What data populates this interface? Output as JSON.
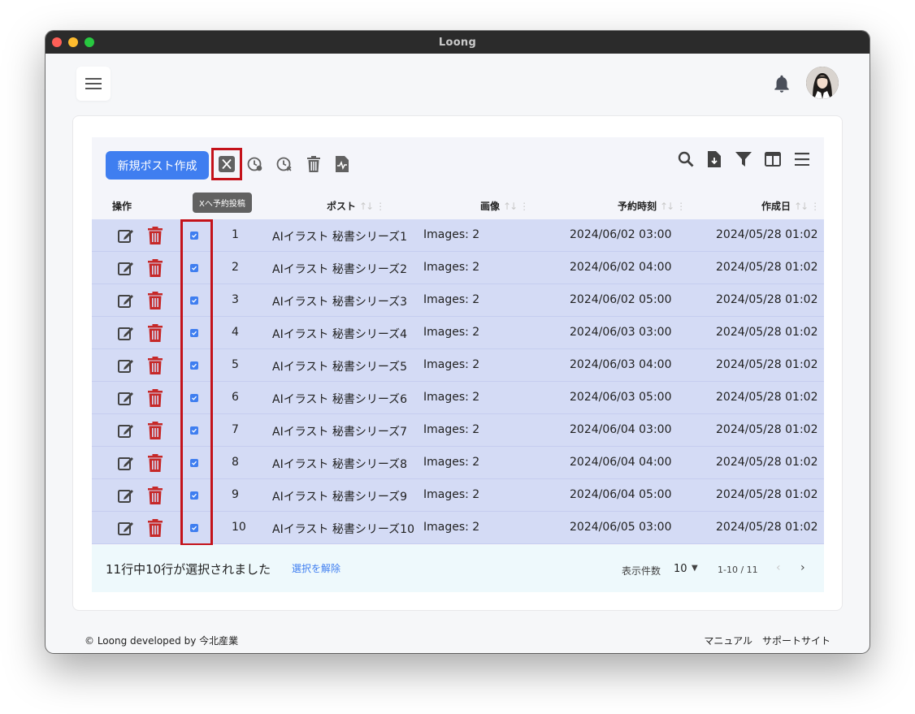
{
  "window": {
    "title": "Loong"
  },
  "toolbar": {
    "new_post_label": "新規ポスト作成",
    "tooltip": "Xへ予約投稿"
  },
  "columns": {
    "actions": "操作",
    "post": "ポスト",
    "image": "画像",
    "scheduled": "予約時刻",
    "created": "作成日"
  },
  "rows": [
    {
      "id": "1",
      "post": "AIイラスト 秘書シリーズ1",
      "image": "Images: 2",
      "scheduled": "2024/06/02 03:00",
      "created": "2024/05/28 01:02"
    },
    {
      "id": "2",
      "post": "AIイラスト 秘書シリーズ2",
      "image": "Images: 2",
      "scheduled": "2024/06/02 04:00",
      "created": "2024/05/28 01:02"
    },
    {
      "id": "3",
      "post": "AIイラスト 秘書シリーズ3",
      "image": "Images: 2",
      "scheduled": "2024/06/02 05:00",
      "created": "2024/05/28 01:02"
    },
    {
      "id": "4",
      "post": "AIイラスト 秘書シリーズ4",
      "image": "Images: 2",
      "scheduled": "2024/06/03 03:00",
      "created": "2024/05/28 01:02"
    },
    {
      "id": "5",
      "post": "AIイラスト 秘書シリーズ5",
      "image": "Images: 2",
      "scheduled": "2024/06/03 04:00",
      "created": "2024/05/28 01:02"
    },
    {
      "id": "6",
      "post": "AIイラスト 秘書シリーズ6",
      "image": "Images: 2",
      "scheduled": "2024/06/03 05:00",
      "created": "2024/05/28 01:02"
    },
    {
      "id": "7",
      "post": "AIイラスト 秘書シリーズ7",
      "image": "Images: 2",
      "scheduled": "2024/06/04 03:00",
      "created": "2024/05/28 01:02"
    },
    {
      "id": "8",
      "post": "AIイラスト 秘書シリーズ8",
      "image": "Images: 2",
      "scheduled": "2024/06/04 04:00",
      "created": "2024/05/28 01:02"
    },
    {
      "id": "9",
      "post": "AIイラスト 秘書シリーズ9",
      "image": "Images: 2",
      "scheduled": "2024/06/04 05:00",
      "created": "2024/05/28 01:02"
    },
    {
      "id": "10",
      "post": "AIイラスト 秘書シリーズ10",
      "image": "Images: 2",
      "scheduled": "2024/06/05 03:00",
      "created": "2024/05/28 01:02"
    }
  ],
  "selection": {
    "status": "11行中10行が選択されました",
    "clear_label": "選択を解除"
  },
  "pagination": {
    "per_page_label": "表示件数",
    "per_page_value": "10",
    "range": "1-10 / 11",
    "prev": "‹",
    "next": "›"
  },
  "footer": {
    "copyright": "© Loong developed by 今北産業",
    "manual_link": "マニュアル",
    "support_link": "サポートサイト"
  },
  "colors": {
    "accent": "#3f7ef0",
    "danger": "#c62828",
    "highlight": "#c4121a",
    "selected_row": "#d4dbf5"
  }
}
